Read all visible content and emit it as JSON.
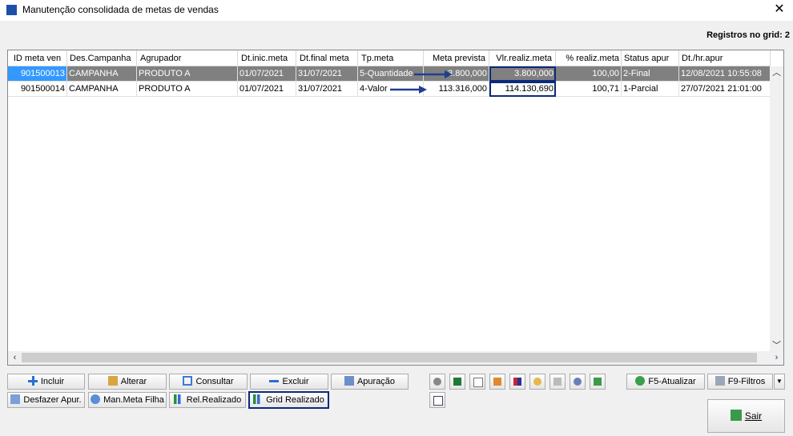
{
  "window": {
    "title": "Manutenção consolidada de metas de vendas",
    "close_glyph": "✕"
  },
  "registros": "Registros no grid: 2",
  "columns": [
    "ID meta ven",
    "Des.Campanha",
    "Agrupador",
    "Dt.inic.meta",
    "Dt.final meta",
    "Tp.meta",
    "Meta prevista",
    "Vlr.realiz.meta",
    "% realiz.meta",
    "Status apur",
    "Dt./hr.apur"
  ],
  "rows": [
    {
      "id": "901500013",
      "campanha": "CAMPANHA",
      "agrupador": "PRODUTO A",
      "dt_inic": "01/07/2021",
      "dt_final": "31/07/2021",
      "tp_meta": "5-Quantidade",
      "meta_prevista": "3.800,000",
      "vlr_realiz": "3.800,000",
      "pct_realiz": "100,00",
      "status": "2-Final",
      "dt_apur": "12/08/2021 10:55:08"
    },
    {
      "id": "901500014",
      "campanha": "CAMPANHA",
      "agrupador": "PRODUTO A",
      "dt_inic": "01/07/2021",
      "dt_final": "31/07/2021",
      "tp_meta": "4-Valor",
      "meta_prevista": "113.316,000",
      "vlr_realiz": "114.130,690",
      "pct_realiz": "100,71",
      "status": "1-Parcial",
      "dt_apur": "27/07/2021 21:01:00"
    }
  ],
  "buttons": {
    "incluir": "Incluir",
    "alterar": "Alterar",
    "consultar": "Consultar",
    "excluir": "Excluir",
    "apuracao": "Apuração",
    "desfazer": "Desfazer Apur.",
    "man_meta_filha": "Man.Meta Filha",
    "rel_realizado": "Rel.Realizado",
    "grid_realizado": "Grid Realizado",
    "atualizar": "F5-Atualizar",
    "filtros": "F9-Filtros",
    "sair": "Sair"
  },
  "colors": {
    "selected_row": "#808080",
    "selected_id": "#3399ff",
    "highlight_border": "#0a2a7a",
    "arrow": "#1f3f8f"
  },
  "icons": [
    "app-icon",
    "plus-icon",
    "edit-icon",
    "search-icon",
    "minus-icon",
    "calc-icon",
    "undo-icon",
    "refresh-icon",
    "chart-icon",
    "export-icon",
    "excel-icon",
    "document-icon",
    "report-icon",
    "columns-icon",
    "palette-icon",
    "print-icon",
    "settings-icon",
    "download-icon",
    "checklist-icon",
    "filter-icon",
    "exit-icon"
  ]
}
